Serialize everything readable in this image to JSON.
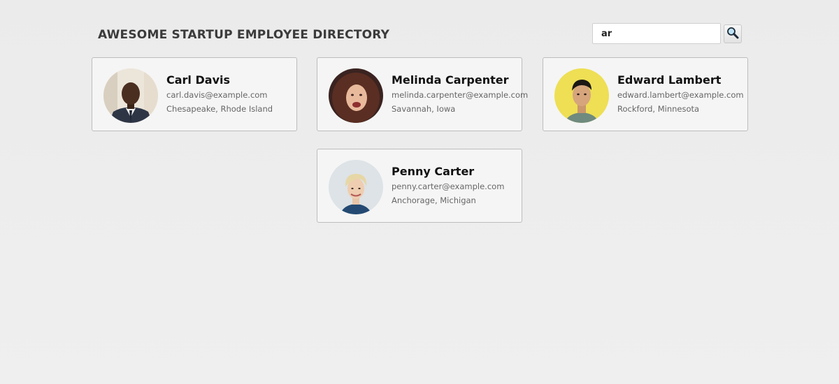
{
  "header": {
    "title": "AWESOME STARTUP EMPLOYEE DIRECTORY"
  },
  "search": {
    "value": "ar",
    "button_icon": "magnifier-icon"
  },
  "employees": [
    {
      "name": "Carl Davis",
      "email": "carl.davis@example.com",
      "location": "Chesapeake, Rhode Island"
    },
    {
      "name": "Melinda Carpenter",
      "email": "melinda.carpenter@example.com",
      "location": "Savannah, Iowa"
    },
    {
      "name": "Edward Lambert",
      "email": "edward.lambert@example.com",
      "location": "Rockford, Minnesota"
    },
    {
      "name": "Penny Carter",
      "email": "penny.carter@example.com",
      "location": "Anchorage, Michigan"
    }
  ],
  "colors": {
    "background": "#ececec",
    "card_background": "#f5f5f5",
    "card_border": "#bdbdbd",
    "title": "#3b3b3b",
    "secondary_text": "#666666"
  }
}
